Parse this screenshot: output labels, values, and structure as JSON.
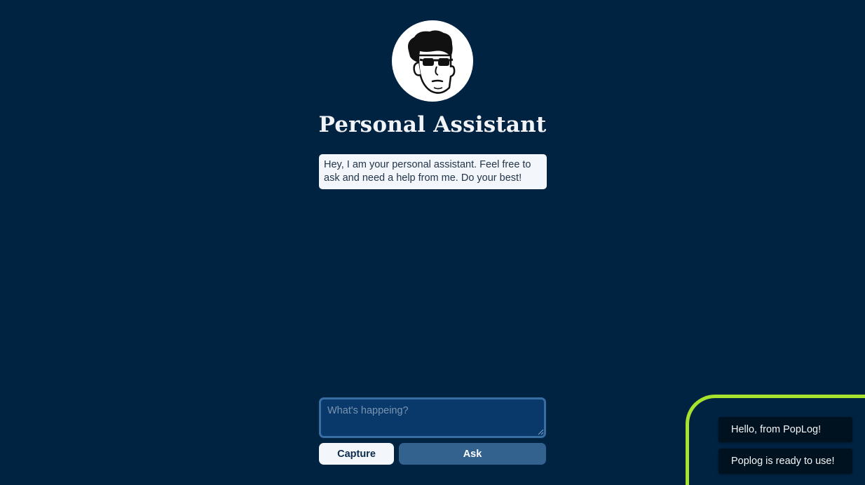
{
  "app": {
    "title": "Personal Assistant",
    "avatar_icon": "cartoon-man-with-sunglasses-icon"
  },
  "chat": {
    "messages": [
      {
        "role": "assistant",
        "text": "Hey, I am your personal assistant. Feel free to ask and need a help from me. Do your best!"
      }
    ]
  },
  "input": {
    "placeholder": "What's happeing?",
    "value": ""
  },
  "buttons": {
    "capture_label": "Capture",
    "ask_label": "Ask"
  },
  "notifications": [
    {
      "text": "Hello, from PopLog!"
    },
    {
      "text": "Poplog is ready to use!"
    }
  ],
  "colors": {
    "background": "#002342",
    "highlight": "#a6e22e",
    "ask_button": "#33628f",
    "input_background": "#08396a"
  }
}
